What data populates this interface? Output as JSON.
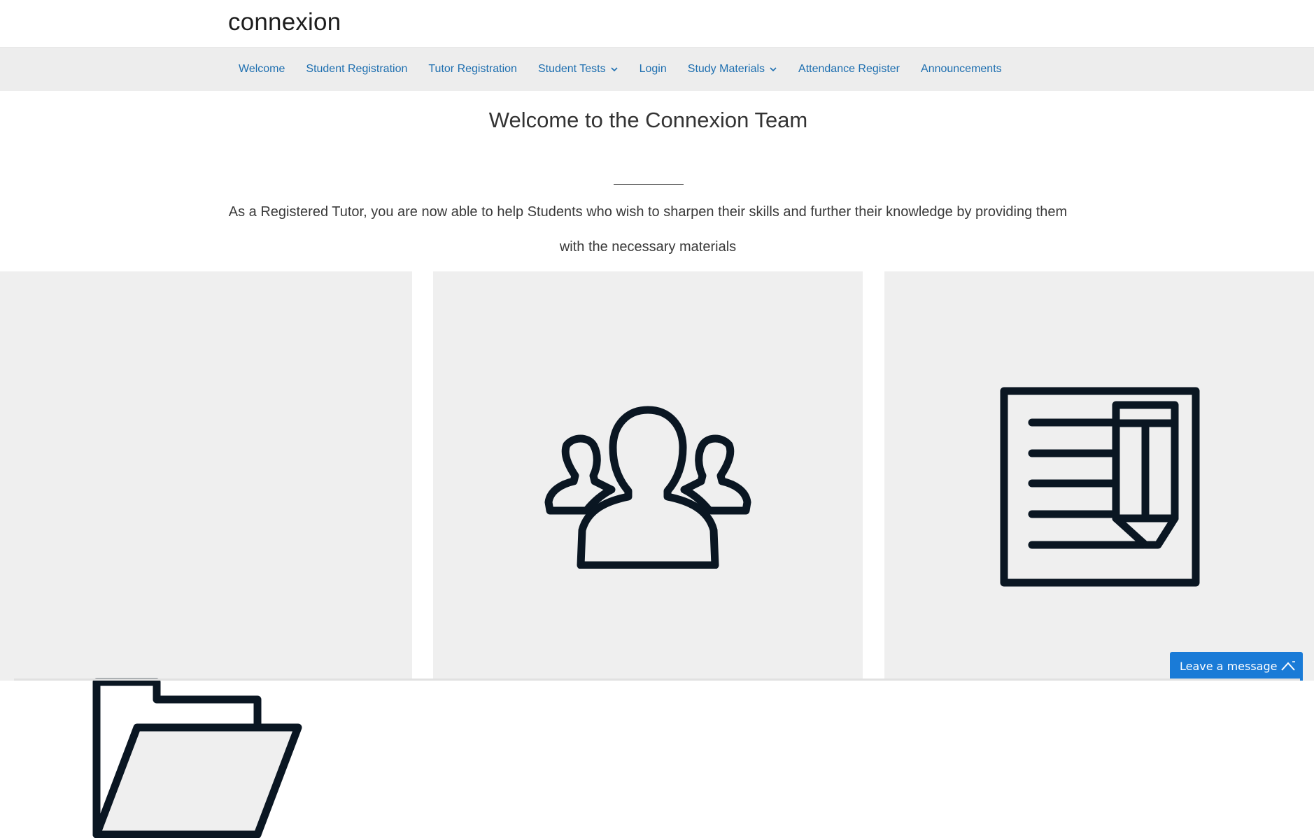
{
  "header": {
    "brand": "connexion"
  },
  "nav": {
    "items": [
      {
        "label": "Welcome",
        "has_dropdown": false
      },
      {
        "label": "Student Registration",
        "has_dropdown": false
      },
      {
        "label": "Tutor Registration",
        "has_dropdown": false
      },
      {
        "label": "Student Tests",
        "has_dropdown": true
      },
      {
        "label": "Login",
        "has_dropdown": false
      },
      {
        "label": "Study Materials",
        "has_dropdown": true
      },
      {
        "label": "Attendance Register",
        "has_dropdown": false
      },
      {
        "label": "Announcements",
        "has_dropdown": false
      }
    ],
    "link_color": "#1e6fb0"
  },
  "main": {
    "title": "Welcome to the Connexion Team",
    "intro": "As a Registered Tutor, you are now able to help Students who wish to sharpen their skills and further their knowledge by providing them with the necessary materials"
  },
  "features": [
    {
      "icon": "folder-icon"
    },
    {
      "icon": "users-group-icon"
    },
    {
      "icon": "document-edit-icon"
    }
  ],
  "chat": {
    "label": "Leave a message",
    "color": "#1a7bd7"
  },
  "colors": {
    "icon_stroke": "#0a1622",
    "card_bg": "#efefef",
    "nav_bg": "#ededed"
  }
}
